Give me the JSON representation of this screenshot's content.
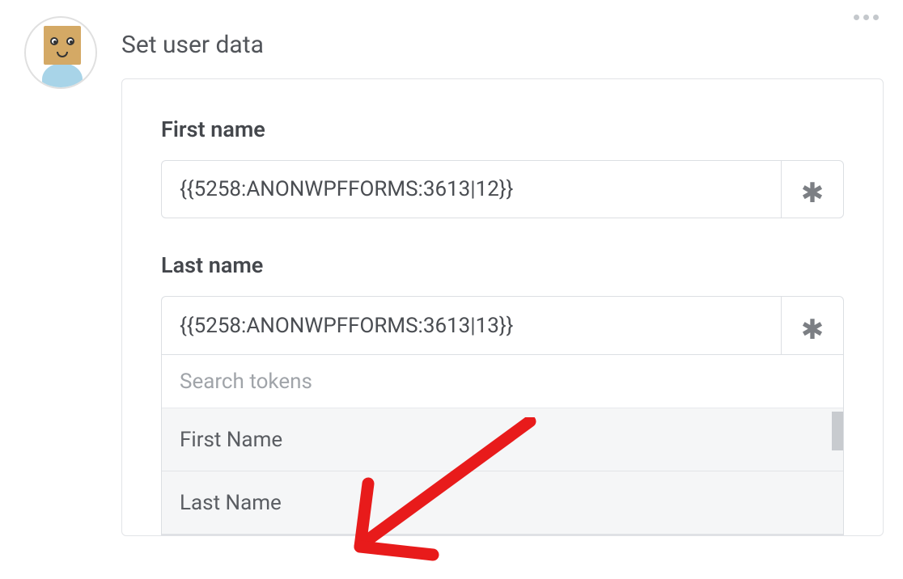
{
  "header": {
    "title": "Set user data"
  },
  "fields": {
    "first_name": {
      "label": "First name",
      "value": "{{5258:ANONWPFFORMS:3613|12}}"
    },
    "last_name": {
      "label": "Last name",
      "value": "{{5258:ANONWPFFORMS:3613|13}}"
    }
  },
  "token_dropdown": {
    "search_placeholder": "Search tokens",
    "options": [
      "First Name",
      "Last Name"
    ]
  }
}
